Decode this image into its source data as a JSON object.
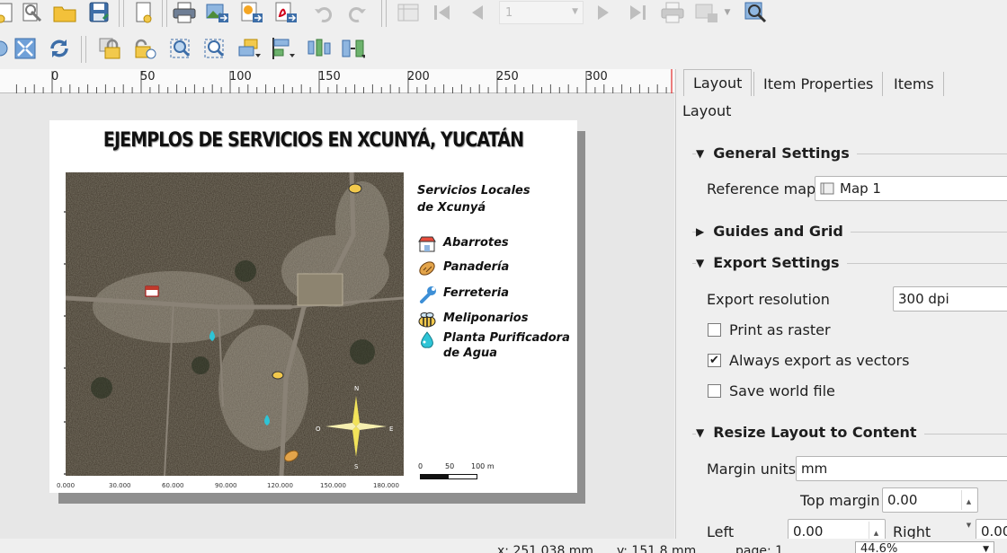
{
  "ruler": {
    "labels": [
      "0",
      "50",
      "100",
      "150",
      "200",
      "250",
      "300"
    ]
  },
  "map_layout": {
    "title": "EJEMPLOS DE SERVICIOS EN XCUNYÁ, YUCATÁN",
    "legend": {
      "title_line1": "Servicios Locales",
      "title_line2": "de Xcunyá",
      "items": [
        {
          "label": "Abarrotes",
          "icon": "store-icon"
        },
        {
          "label": "Panadería",
          "icon": "bread-icon"
        },
        {
          "label": "Ferreteria",
          "icon": "wrench-icon"
        },
        {
          "label": "Meliponarios",
          "icon": "bee-icon"
        },
        {
          "label": "Planta Purificadora",
          "label2": "de Agua",
          "icon": "water-drop-icon"
        }
      ]
    },
    "north_arrow": {
      "n": "N",
      "s": "S",
      "e": "E",
      "o": "O"
    },
    "scale_bar": {
      "labels": [
        "0",
        "50",
        "100 m"
      ]
    },
    "x_ticks": [
      "0.000",
      "30.000",
      "60.000",
      "90.000",
      "120.000",
      "150.000",
      "180.000"
    ]
  },
  "panel": {
    "tabs": [
      "Layout",
      "Item Properties",
      "Items"
    ],
    "header": "Layout",
    "general_settings": {
      "title": "General Settings",
      "reference_map_label": "Reference map",
      "reference_map_value": "Map 1"
    },
    "guides": {
      "title": "Guides and Grid"
    },
    "export": {
      "title": "Export Settings",
      "resolution_label": "Export resolution",
      "resolution_value": "300 dpi",
      "print_raster": "Print as raster",
      "always_vectors": "Always export as vectors",
      "save_world": "Save world file"
    },
    "resize": {
      "title": "Resize Layout to Content",
      "margin_units_label": "Margin units",
      "margin_units_value": "mm",
      "top_margin_label": "Top margin",
      "top_margin_value": "0.00",
      "left_label": "Left",
      "left_value": "0.00",
      "right_label": "Right",
      "right_value": "0.00"
    }
  },
  "toolbar": {
    "page_number": "1"
  },
  "status": {
    "x": "x: 251.038 mm",
    "y": "y: 151.8 mm",
    "page": "page: 1",
    "zoom": "44.6%"
  },
  "colors": {
    "accent_yellow": "#f2c94c",
    "map_green": "#4a4a3a"
  }
}
